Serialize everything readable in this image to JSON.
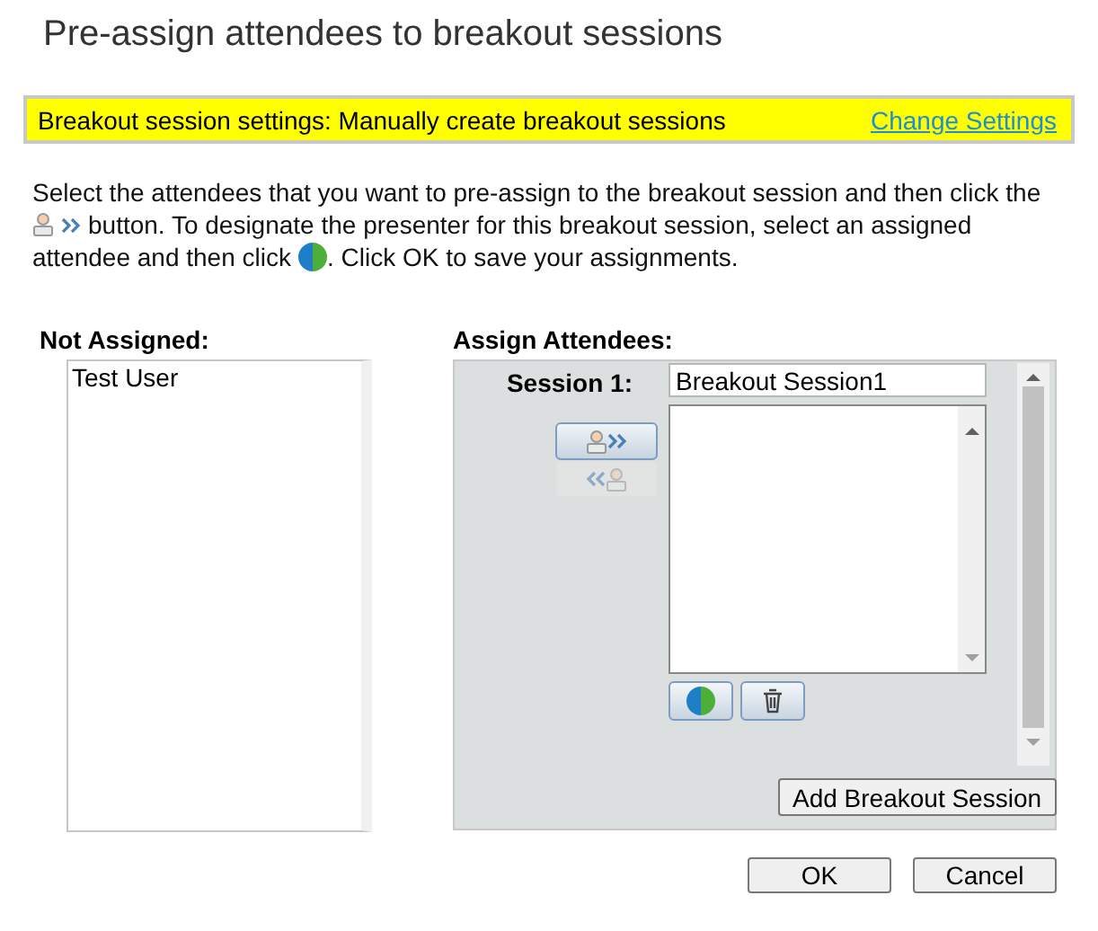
{
  "title": "Pre-assign attendees to breakout sessions",
  "settings_bar": {
    "text": "Breakout session settings: Manually create breakout sessions",
    "link": "Change Settings"
  },
  "instructions": [
    "Select the attendees that you want to pre-assign to the breakout session and then click the",
    "button. To designate the presenter for this breakout session, select an assigned",
    "attendee and then click",
    ". Click OK to save your assignments."
  ],
  "not_assigned": {
    "heading": "Not Assigned:",
    "items": [
      {
        "name": "Test User",
        "selected": false
      }
    ]
  },
  "assign": {
    "heading": "Assign Attendees:",
    "sessions": [
      {
        "label": "Session 1:",
        "name": "Breakout Session1"
      }
    ],
    "move_buttons": [
      {
        "kind": "assign",
        "disabled": false
      },
      {
        "kind": "unassign",
        "disabled": true
      }
    ],
    "add_button": "Add Breakout Session"
  },
  "buttons": [
    "OK",
    "Cancel"
  ]
}
